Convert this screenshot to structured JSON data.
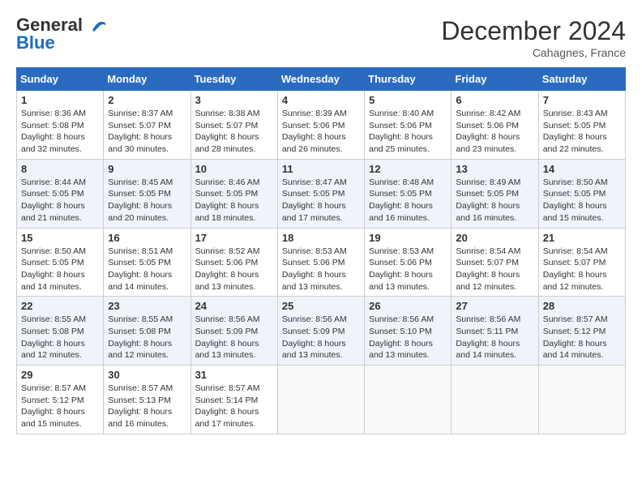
{
  "app": {
    "logo_general": "General",
    "logo_blue": "Blue",
    "title": "December 2024",
    "location": "Cahagnes, France"
  },
  "calendar": {
    "headers": [
      "Sunday",
      "Monday",
      "Tuesday",
      "Wednesday",
      "Thursday",
      "Friday",
      "Saturday"
    ],
    "weeks": [
      [
        {
          "day": "1",
          "info": "Sunrise: 8:36 AM\nSunset: 5:08 PM\nDaylight: 8 hours\nand 32 minutes."
        },
        {
          "day": "2",
          "info": "Sunrise: 8:37 AM\nSunset: 5:07 PM\nDaylight: 8 hours\nand 30 minutes."
        },
        {
          "day": "3",
          "info": "Sunrise: 8:38 AM\nSunset: 5:07 PM\nDaylight: 8 hours\nand 28 minutes."
        },
        {
          "day": "4",
          "info": "Sunrise: 8:39 AM\nSunset: 5:06 PM\nDaylight: 8 hours\nand 26 minutes."
        },
        {
          "day": "5",
          "info": "Sunrise: 8:40 AM\nSunset: 5:06 PM\nDaylight: 8 hours\nand 25 minutes."
        },
        {
          "day": "6",
          "info": "Sunrise: 8:42 AM\nSunset: 5:06 PM\nDaylight: 8 hours\nand 23 minutes."
        },
        {
          "day": "7",
          "info": "Sunrise: 8:43 AM\nSunset: 5:05 PM\nDaylight: 8 hours\nand 22 minutes."
        }
      ],
      [
        {
          "day": "8",
          "info": "Sunrise: 8:44 AM\nSunset: 5:05 PM\nDaylight: 8 hours\nand 21 minutes."
        },
        {
          "day": "9",
          "info": "Sunrise: 8:45 AM\nSunset: 5:05 PM\nDaylight: 8 hours\nand 20 minutes."
        },
        {
          "day": "10",
          "info": "Sunrise: 8:46 AM\nSunset: 5:05 PM\nDaylight: 8 hours\nand 18 minutes."
        },
        {
          "day": "11",
          "info": "Sunrise: 8:47 AM\nSunset: 5:05 PM\nDaylight: 8 hours\nand 17 minutes."
        },
        {
          "day": "12",
          "info": "Sunrise: 8:48 AM\nSunset: 5:05 PM\nDaylight: 8 hours\nand 16 minutes."
        },
        {
          "day": "13",
          "info": "Sunrise: 8:49 AM\nSunset: 5:05 PM\nDaylight: 8 hours\nand 16 minutes."
        },
        {
          "day": "14",
          "info": "Sunrise: 8:50 AM\nSunset: 5:05 PM\nDaylight: 8 hours\nand 15 minutes."
        }
      ],
      [
        {
          "day": "15",
          "info": "Sunrise: 8:50 AM\nSunset: 5:05 PM\nDaylight: 8 hours\nand 14 minutes."
        },
        {
          "day": "16",
          "info": "Sunrise: 8:51 AM\nSunset: 5:05 PM\nDaylight: 8 hours\nand 14 minutes."
        },
        {
          "day": "17",
          "info": "Sunrise: 8:52 AM\nSunset: 5:06 PM\nDaylight: 8 hours\nand 13 minutes."
        },
        {
          "day": "18",
          "info": "Sunrise: 8:53 AM\nSunset: 5:06 PM\nDaylight: 8 hours\nand 13 minutes."
        },
        {
          "day": "19",
          "info": "Sunrise: 8:53 AM\nSunset: 5:06 PM\nDaylight: 8 hours\nand 13 minutes."
        },
        {
          "day": "20",
          "info": "Sunrise: 8:54 AM\nSunset: 5:07 PM\nDaylight: 8 hours\nand 12 minutes."
        },
        {
          "day": "21",
          "info": "Sunrise: 8:54 AM\nSunset: 5:07 PM\nDaylight: 8 hours\nand 12 minutes."
        }
      ],
      [
        {
          "day": "22",
          "info": "Sunrise: 8:55 AM\nSunset: 5:08 PM\nDaylight: 8 hours\nand 12 minutes."
        },
        {
          "day": "23",
          "info": "Sunrise: 8:55 AM\nSunset: 5:08 PM\nDaylight: 8 hours\nand 12 minutes."
        },
        {
          "day": "24",
          "info": "Sunrise: 8:56 AM\nSunset: 5:09 PM\nDaylight: 8 hours\nand 13 minutes."
        },
        {
          "day": "25",
          "info": "Sunrise: 8:56 AM\nSunset: 5:09 PM\nDaylight: 8 hours\nand 13 minutes."
        },
        {
          "day": "26",
          "info": "Sunrise: 8:56 AM\nSunset: 5:10 PM\nDaylight: 8 hours\nand 13 minutes."
        },
        {
          "day": "27",
          "info": "Sunrise: 8:56 AM\nSunset: 5:11 PM\nDaylight: 8 hours\nand 14 minutes."
        },
        {
          "day": "28",
          "info": "Sunrise: 8:57 AM\nSunset: 5:12 PM\nDaylight: 8 hours\nand 14 minutes."
        }
      ],
      [
        {
          "day": "29",
          "info": "Sunrise: 8:57 AM\nSunset: 5:12 PM\nDaylight: 8 hours\nand 15 minutes."
        },
        {
          "day": "30",
          "info": "Sunrise: 8:57 AM\nSunset: 5:13 PM\nDaylight: 8 hours\nand 16 minutes."
        },
        {
          "day": "31",
          "info": "Sunrise: 8:57 AM\nSunset: 5:14 PM\nDaylight: 8 hours\nand 17 minutes."
        },
        null,
        null,
        null,
        null
      ]
    ]
  }
}
